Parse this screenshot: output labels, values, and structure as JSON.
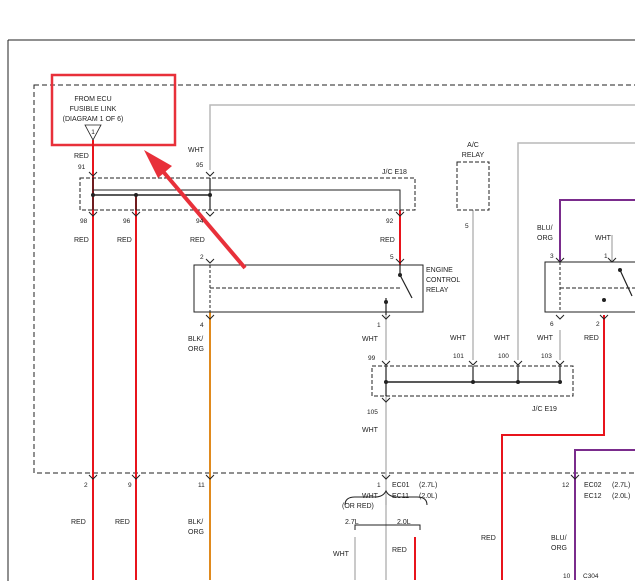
{
  "source_block": {
    "line1": "FROM ECU",
    "line2": "FUSIBLE LINK",
    "line3": "(DIAGRAM 1 OF 6)",
    "pin": "1"
  },
  "junction_top": {
    "name": "J/C E18"
  },
  "junction_mid": {
    "name": "J/C E19"
  },
  "ac_relay": {
    "line1": "A/C",
    "line2": "RELAY",
    "pin": "5"
  },
  "engine_relay": {
    "line1": "ENGINE",
    "line2": "CONTROL",
    "line3": "RELAY"
  },
  "wire_labels": {
    "red_src": "RED",
    "pin_91": "91",
    "wht_95_lbl": "WHT",
    "pin_95": "95",
    "pin_98": "98",
    "pin_96": "96",
    "pin_94": "94",
    "pin_92": "92",
    "red_a": "RED",
    "red_b": "RED",
    "red_c": "RED",
    "red_d": "RED",
    "er_pin2": "2",
    "er_pin5": "5",
    "er_pin4": "4",
    "er_pin1": "1",
    "blk1": "BLK/",
    "org1": "ORG",
    "wht_er1": "WHT",
    "pin_99": "99",
    "pin_105": "105",
    "wht_105": "WHT",
    "pin_101": "101",
    "wht_101": "WHT",
    "pin_100": "100",
    "wht_100": "WHT",
    "pin_103": "103",
    "wht_103": "WHT",
    "blu_r": "BLU/",
    "org_r": "ORG",
    "wht_r": "WHT",
    "r_pin3": "3",
    "r_pin1": "1",
    "r_pin6": "6",
    "r_pin2": "2",
    "red_r": "RED",
    "bot_pin2": "2",
    "bot_pin9": "9",
    "bot_pin11": "11",
    "bot_pin1": "1",
    "bot_red1": "RED",
    "bot_red2": "RED",
    "bot_blk": "BLK/",
    "bot_org": "ORG",
    "ec01": "EC01",
    "ec01_v": "(2.7L)",
    "ec11": "EC11",
    "ec11_v": "(2.0L)",
    "wht_bot": "WHT",
    "or_red": "(OR RED)",
    "l27": "2.7L",
    "l20": "2.0L",
    "wht_27": "WHT",
    "red_20": "RED",
    "red_mid": "RED",
    "bot_pin12": "12",
    "ec02": "EC02",
    "ec02_v": "(2.7L)",
    "ec12": "EC12",
    "ec12_v": "(2.0L)",
    "blu2": "BLU/",
    "org2": "ORG",
    "pin_10": "10",
    "c304": "C304"
  },
  "colors": {
    "red": "#e8141c",
    "orange": "#e08a1e",
    "purple": "#7a2c8c",
    "gray": "#b9b9b9",
    "highlight": "#e8303a",
    "black": "#222222"
  }
}
